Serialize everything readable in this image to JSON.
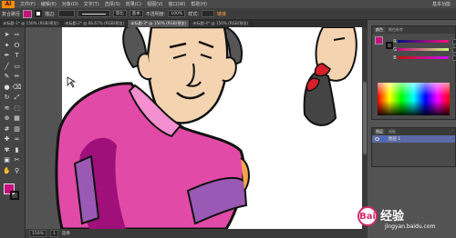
{
  "app": {
    "logo": "Ai"
  },
  "menubar": {
    "items": [
      "文件(F)",
      "编辑(E)",
      "对象(O)",
      "文字(T)",
      "选择(S)",
      "效果(C)",
      "视图(V)",
      "窗口(W)",
      "帮助(H)"
    ],
    "workspace": "基本功能"
  },
  "control_bar": {
    "selection_label": "复合路径",
    "stroke_label": "描边:",
    "stroke_profile": "等比",
    "brush": "基本",
    "opacity_label": "不透明度:",
    "opacity_value": "100%",
    "style_label": "样式:",
    "link_label": "链接",
    "fill_color": "#c8107f",
    "stroke_color": "#222222"
  },
  "document_tabs": [
    {
      "label": "未标题-1* @ 150% (RGB/预览)",
      "active": false
    },
    {
      "label": "未标题-2* @ 66.67% (RGB/预览)",
      "active": false
    },
    {
      "label": "未标题-3* @ 150% (RGB/预览)",
      "active": true
    },
    {
      "label": "未标题-4* @ 150% (RGB/预览)",
      "active": false
    }
  ],
  "tools": [
    "selection-tool-icon",
    "direct-selection-tool-icon",
    "magic-wand-tool-icon",
    "lasso-tool-icon",
    "pen-tool-icon",
    "type-tool-icon",
    "line-tool-icon",
    "rectangle-tool-icon",
    "paintbrush-tool-icon",
    "pencil-tool-icon",
    "blob-brush-tool-icon",
    "eraser-tool-icon",
    "rotate-tool-icon",
    "scale-tool-icon",
    "width-tool-icon",
    "free-transform-tool-icon",
    "shape-builder-tool-icon",
    "perspective-tool-icon",
    "mesh-tool-icon",
    "gradient-tool-icon",
    "eyedropper-tool-icon",
    "blend-tool-icon",
    "symbol-sprayer-tool-icon",
    "column-graph-tool-icon",
    "artboard-tool-icon",
    "slice-tool-icon",
    "hand-tool-icon",
    "zoom-tool-icon"
  ],
  "tool_glyphs": [
    "➤",
    "⇨",
    "✦",
    "ⵔ",
    "✒",
    "T",
    "╱",
    "▭",
    "✎",
    "✏",
    "●",
    "⌫",
    "↻",
    "⤢",
    "≋",
    "⬚",
    "⊕",
    "▦",
    "#",
    "▥",
    "✚",
    "∞",
    "✾",
    "▮",
    "▣",
    "✂",
    "✋",
    "⚲"
  ],
  "status_bar": {
    "zoom": "150%",
    "page": "1",
    "tool": "选择"
  },
  "panels": {
    "color": {
      "tabs": [
        "颜色",
        "颜色参考"
      ],
      "channels": [
        "R",
        "G",
        "B"
      ],
      "values": [
        200,
        16,
        127
      ]
    },
    "layers": {
      "tabs": [
        "图层",
        "画板"
      ],
      "rows": [
        {
          "name": "图层 1",
          "selected": true
        }
      ]
    }
  },
  "watermark": {
    "brand": "Bai",
    "text": "经验",
    "url": "jingyan.baidu.com"
  },
  "art_colors": {
    "jacket": "#e24aa8",
    "jacket_dark": "#a0107a",
    "jacket_light": "#f48fd0",
    "skin": "#f4d3b0",
    "hair": "#555555",
    "sleeve": "#9b59b6"
  }
}
